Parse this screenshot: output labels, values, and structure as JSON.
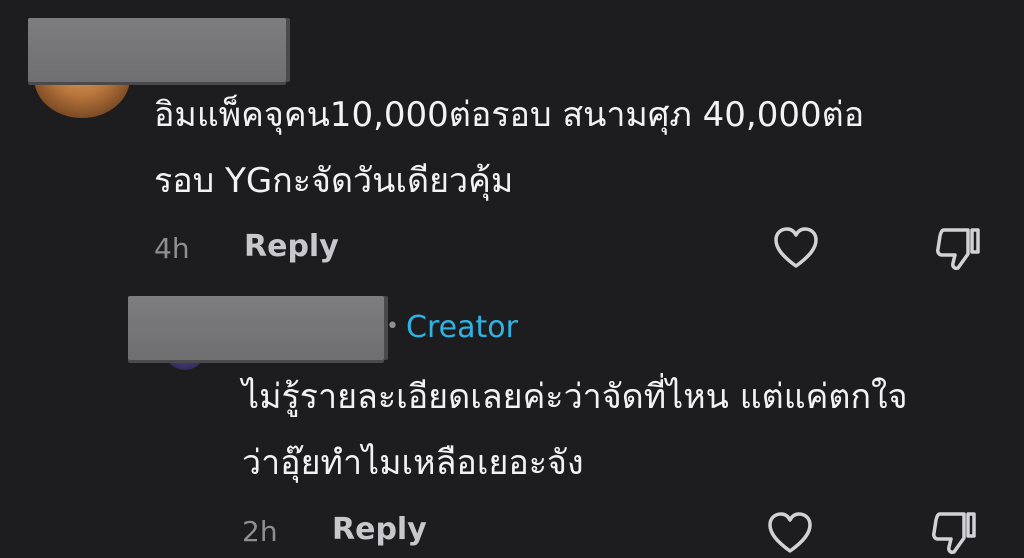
{
  "comments": [
    {
      "text_line1": "อิมแพ็คจุคน10,000ต่อรอบ สนามศุภ 40,000ต่อ",
      "text_line2": "รอบ YGกะจัดวันเดียวคุ้ม",
      "time": "4h",
      "reply_label": "Reply"
    }
  ],
  "replies": [
    {
      "badge_dot": "•",
      "badge": "Creator",
      "text_line1": "ไม่รู้รายละเอียดเลยค่ะว่าจัดที่ไหน แต่แค่ตกใจ",
      "text_line2": "ว่าอุ๊ยทำไมเหลือเยอะจัง",
      "time": "2h",
      "reply_label": "Reply"
    }
  ],
  "icons": {
    "like": "heart-icon",
    "dislike": "thumbs-down-icon"
  },
  "colors": {
    "background": "#1d1d1f",
    "text": "#f2f2f4",
    "muted": "#8e8e93",
    "creator": "#2fb3e5",
    "redaction": "#777779"
  }
}
